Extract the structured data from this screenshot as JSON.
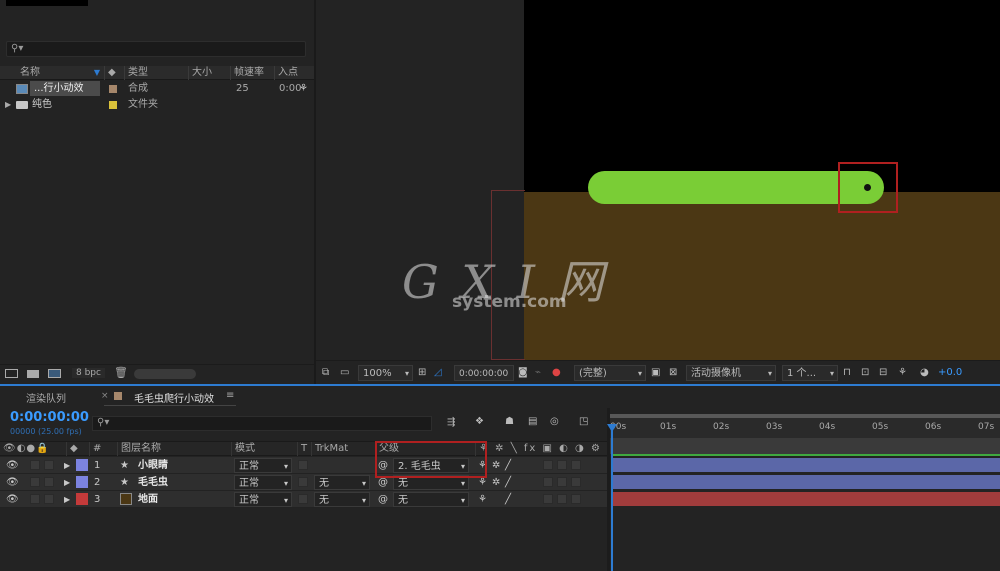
{
  "project": {
    "columns": {
      "name": "名称",
      "type": "类型",
      "size": "大小",
      "framerate": "帧速率",
      "in_point": "入点"
    },
    "items": [
      {
        "name": "...行小动效",
        "type": "合成",
        "framerate": "25",
        "in_point": "0:00",
        "color": "#a6876b"
      },
      {
        "name": "纯色",
        "type": "文件夹",
        "framerate": "",
        "in_point": "",
        "color": "#d9c13a"
      }
    ],
    "bpc": "8 bpc"
  },
  "viewer": {
    "zoom": "100%",
    "timecode": "0:00:00:00",
    "resolution": "(完整)",
    "camera": "活动摄像机",
    "views": "1 个...",
    "exposure": "+0.0",
    "colors": {
      "background": "#000000",
      "ground": "#4b3714",
      "worm": "#7acd36",
      "highlight": "#b02020"
    }
  },
  "timeline": {
    "tabs": [
      {
        "label": "渲染队列"
      },
      {
        "label": "毛毛虫爬行小动效"
      }
    ],
    "timecode": "0:00:00:00",
    "fps": "00000 (25.00 fps)",
    "layer_columns": {
      "num": "#",
      "name": "图层名称",
      "mode": "模式",
      "t": "T",
      "trkmat": "TrkMat",
      "parent": "父级"
    },
    "layers": [
      {
        "num": "1",
        "name": "小眼睛",
        "mode": "正常",
        "trkmat": "",
        "parent": "2. 毛毛虫",
        "label_color": "#7c83e0",
        "shape": true
      },
      {
        "num": "2",
        "name": "毛毛虫",
        "mode": "正常",
        "trkmat": "无",
        "parent": "无",
        "label_color": "#7c83e0",
        "shape": true
      },
      {
        "num": "3",
        "name": "地面",
        "mode": "正常",
        "trkmat": "无",
        "parent": "无",
        "label_color": "#c43a3a",
        "shape": false
      }
    ],
    "ruler_ticks": [
      "00s",
      "01s",
      "02s",
      "03s",
      "04s",
      "05s",
      "06s",
      "07s"
    ]
  },
  "watermark": {
    "text1": "G X I 网",
    "text2": "system.com"
  }
}
